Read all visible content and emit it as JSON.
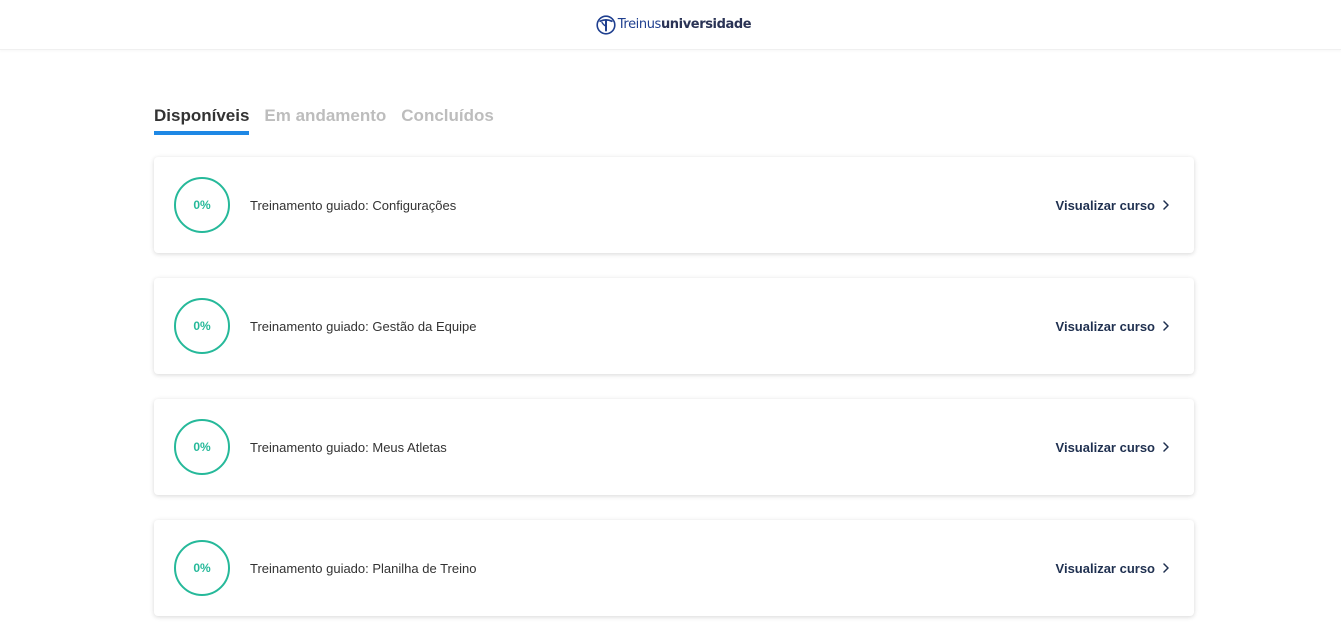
{
  "header": {
    "logo_brand": "Treinus",
    "logo_sub": "universidade"
  },
  "tabs": [
    {
      "label": "Disponíveis",
      "active": true
    },
    {
      "label": "Em andamento",
      "active": false
    },
    {
      "label": "Concluídos",
      "active": false
    }
  ],
  "courses": [
    {
      "progress": "0%",
      "title": "Treinamento guiado: Configurações",
      "link": "Visualizar curso"
    },
    {
      "progress": "0%",
      "title": "Treinamento guiado: Gestão da Equipe",
      "link": "Visualizar curso"
    },
    {
      "progress": "0%",
      "title": "Treinamento guiado: Meus Atletas",
      "link": "Visualizar curso"
    },
    {
      "progress": "0%",
      "title": "Treinamento guiado: Planilha de Treino",
      "link": "Visualizar curso"
    }
  ],
  "icons": {
    "logo": "treinus-logo-icon",
    "link_arrow": "chevron-right-icon"
  },
  "colors": {
    "accent_tab": "#1e88e5",
    "progress": "#26b99a",
    "brand": "#1f3f8f"
  }
}
